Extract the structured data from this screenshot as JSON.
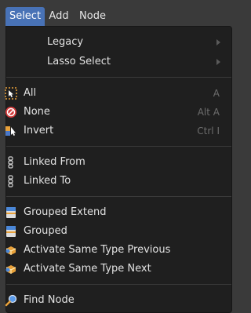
{
  "menubar": {
    "items": [
      {
        "label": "Select"
      },
      {
        "label": "Add"
      },
      {
        "label": "Node"
      }
    ]
  },
  "menu": {
    "legacy": {
      "label": "Legacy"
    },
    "lasso_select": {
      "label": "Lasso Select"
    },
    "all": {
      "label": "All",
      "shortcut": "A"
    },
    "none": {
      "label": "None",
      "shortcut": "Alt A"
    },
    "invert": {
      "label": "Invert",
      "shortcut": "Ctrl I"
    },
    "linked_from": {
      "label": "Linked From"
    },
    "linked_to": {
      "label": "Linked To"
    },
    "grouped_extend": {
      "label": "Grouped Extend"
    },
    "grouped": {
      "label": "Grouped"
    },
    "activate_same_type_previous": {
      "label": "Activate Same Type Previous"
    },
    "activate_same_type_next": {
      "label": "Activate Same Type Next"
    },
    "find_node": {
      "label": "Find Node"
    }
  },
  "colors": {
    "accent": "#4872b6",
    "menu_bg": "#1f1f1f",
    "header_bg": "#3a3a3a",
    "text": "#e2e2e2",
    "shortcut": "#6d6d6d"
  }
}
